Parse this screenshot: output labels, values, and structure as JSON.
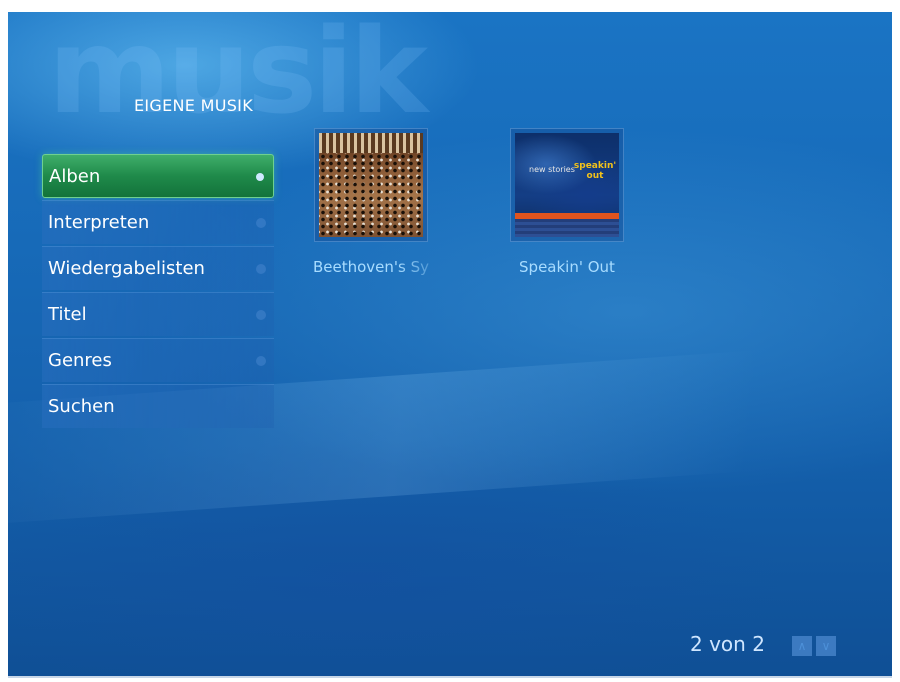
{
  "background": {
    "watermark_text": "musik",
    "primary_color": "#176ab8",
    "selection_color": "#1f8a4a"
  },
  "header": {
    "title": "EIGENE MUSIK"
  },
  "menu": {
    "items": [
      {
        "label": "Alben",
        "selected": true
      },
      {
        "label": "Interpreten",
        "selected": false
      },
      {
        "label": "Wiedergabelisten",
        "selected": false
      },
      {
        "label": "Titel",
        "selected": false
      },
      {
        "label": "Genres",
        "selected": false
      },
      {
        "label": "Suchen",
        "selected": false
      }
    ]
  },
  "albums": [
    {
      "title": "Beethoven's Sy",
      "cover_icon": "orchestra-cover"
    },
    {
      "title": "Speakin' Out",
      "cover_icon": "jazz-cover",
      "cover_text_1": "new stories",
      "cover_text_2": "speakin' out"
    }
  ],
  "pager": {
    "text": "2 von 2",
    "up_icon": "chevron-up-icon",
    "down_icon": "chevron-down-icon",
    "up_glyph": "∧",
    "down_glyph": "∨"
  }
}
